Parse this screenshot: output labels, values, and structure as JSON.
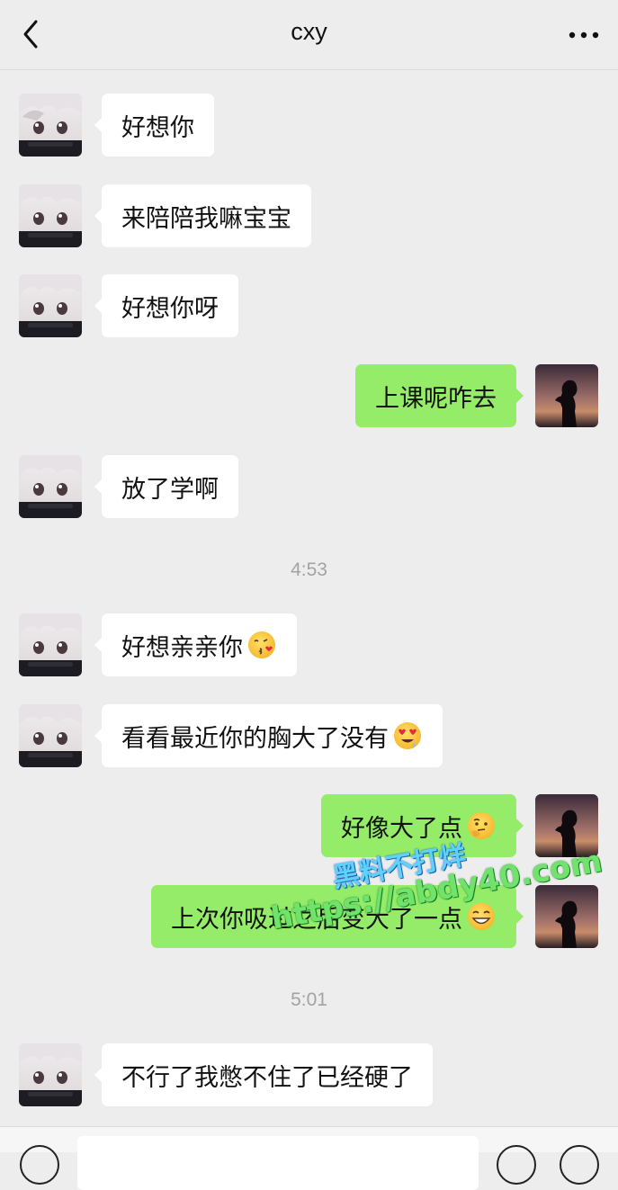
{
  "header": {
    "title": "cxy",
    "back_icon": "chevron-left-icon",
    "more_icon": "more-dots-icon"
  },
  "colors": {
    "background": "#ededed",
    "incoming_bubble": "#ffffff",
    "outgoing_bubble": "#95ec69",
    "timestamp_text": "#a3a3a3"
  },
  "messages": [
    {
      "side": "in",
      "text": "好想你"
    },
    {
      "side": "in",
      "text": "来陪陪我嘛宝宝"
    },
    {
      "side": "in",
      "text": "好想你呀"
    },
    {
      "side": "out",
      "text": "上课呢咋去"
    },
    {
      "side": "in",
      "text": "放了学啊"
    },
    {
      "timestamp": "4:53"
    },
    {
      "side": "in",
      "text": "好想亲亲你",
      "emoji": "kissing-heart-emoji"
    },
    {
      "side": "in",
      "text": "看看最近你的胸大了没有",
      "emoji": "heart-eyes-emoji"
    },
    {
      "side": "out",
      "text": "好像大了点",
      "emoji": "thinking-face-emoji"
    },
    {
      "side": "out",
      "text": "上次你吸过之后变大了一点",
      "emoji": "grinning-face-emoji"
    },
    {
      "timestamp": "5:01"
    },
    {
      "side": "in",
      "text": "不行了我憋不住了已经硬了"
    }
  ],
  "watermark": {
    "line1": "黑料不打烊",
    "line2": "https://abdy40.com"
  },
  "input_bar": {
    "voice_icon": "voice-icon",
    "emoji_icon": "emoji-icon",
    "plus_icon": "plus-icon"
  }
}
